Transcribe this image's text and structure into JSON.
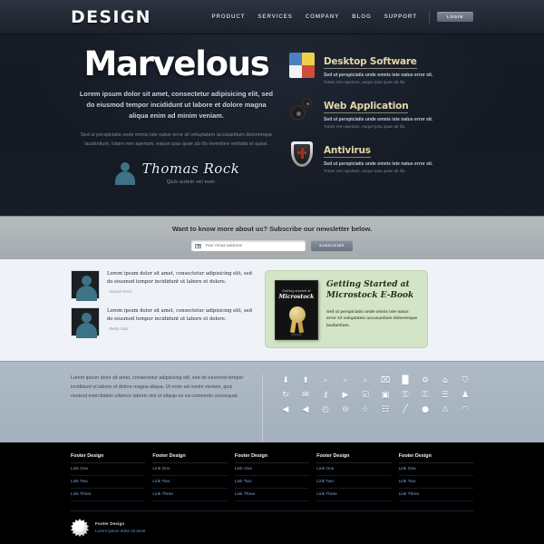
{
  "header": {
    "logo": "DESIGN",
    "nav": [
      {
        "label": "PRODUCT"
      },
      {
        "label": "SERVICES"
      },
      {
        "label": "COMPANY"
      },
      {
        "label": "BLOG"
      },
      {
        "label": "SUPPORT"
      }
    ],
    "login_label": "LOGIN"
  },
  "hero": {
    "title": "Marvelous",
    "subtitle": "Lorem ipsum dolor sit amet, consectetur adipisicing elit, sed do eiusmod tempor incididunt ut labore et dolore magna aliqua  enim ad minim veniam.",
    "body": "Sed ut perspiciatis unde omnis iste natus error sit voluptatem accusantium doloremque laudantium, totam rem aperiam, eaque ipsa quae ab illo inventore veritatis et quasi.",
    "signature_name": "Thomas Rock",
    "signature_role": "Quis autem vel eum",
    "features": [
      {
        "icon": "puzzle-icon",
        "title": "Desktop Software",
        "line1": "Sed ut perspiciatis unde omnis iste natus error sit.",
        "line2": "Totam rem aperiam, eaque ipsa quae ab illo."
      },
      {
        "icon": "gears-icon",
        "title": "Web Application",
        "line1": "Sed ut perspiciatis unde omnis iste natus error sit.",
        "line2": "Totam rem aperiam, eaque ipsa quae ab illo."
      },
      {
        "icon": "shield-icon",
        "title": "Antivirus",
        "line1": "Sed ut perspiciatis unde omnis iste natus error sit.",
        "line2": "Totam rem aperiam, eaque ipsa quae ab illo."
      }
    ]
  },
  "newsletter": {
    "title": "Want to know more about us? Subscribe our newsletter below.",
    "input_placeholder": "Your email address",
    "input_value": "",
    "button_label": "SUBSCRIBE"
  },
  "testimonials": [
    {
      "text": "Lorem ipsum dolor sit amet, consectetur adipisicing elit, sed do eiusmod tempor incididunt ut labore et dolore.",
      "author": "- Daniel Ross"
    },
    {
      "text": "Lorem ipsum dolor sit amet, consectetur adipisicing elit, sed do eiusmod tempor incididunt ut labore et dolore.",
      "author": "- Betty Diaz"
    }
  ],
  "ebook": {
    "cover_top": "Getting started at",
    "cover_title": "Microstock",
    "cover_footer": "Promo.kit",
    "title": "Getting Started at Microstock E-Book",
    "body": "Sed ut perspiciatis unde omnis iste natus error sit voluptatem accusantium doloremque laudantium."
  },
  "icons_section": {
    "paragraph": "Lorem ipsum dolor sit amet, consectetur adipisicing elit, sed do eiusmod tempor incididunt ut labore et dolore magna aliqua. Ut enim ad minim veniam, quis nostrud exercitation ullamco laboris nisi ut aliquip ex ea commodo consequat.",
    "icons": [
      {
        "name": "arrow-down-icon",
        "glyph": "⬇"
      },
      {
        "name": "arrow-up-icon",
        "glyph": "⬆"
      },
      {
        "name": "zoom-in-icon",
        "glyph": "⌕"
      },
      {
        "name": "zoom-out-icon",
        "glyph": "⌕"
      },
      {
        "name": "search-icon",
        "glyph": "⌕"
      },
      {
        "name": "trash-icon",
        "glyph": "⌧"
      },
      {
        "name": "bar-chart-icon",
        "glyph": "█"
      },
      {
        "name": "gear-icon",
        "glyph": "⚙"
      },
      {
        "name": "home-icon",
        "glyph": "⌂"
      },
      {
        "name": "cart-icon",
        "glyph": "⛉"
      },
      {
        "name": "refresh-icon",
        "glyph": "↻"
      },
      {
        "name": "mail-icon",
        "glyph": "✉"
      },
      {
        "name": "key-icon",
        "glyph": "⚷"
      },
      {
        "name": "play-icon",
        "glyph": "▶"
      },
      {
        "name": "checkbox-icon",
        "glyph": "☑"
      },
      {
        "name": "box-up-icon",
        "glyph": "▣"
      },
      {
        "name": "lock-icon",
        "glyph": "⚿"
      },
      {
        "name": "unlock-icon",
        "glyph": "⚿"
      },
      {
        "name": "document-icon",
        "glyph": "☰"
      },
      {
        "name": "user-icon",
        "glyph": "♟"
      },
      {
        "name": "volume-on-icon",
        "glyph": "◀"
      },
      {
        "name": "volume-off-icon",
        "glyph": "◀"
      },
      {
        "name": "clock-icon",
        "glyph": "◴"
      },
      {
        "name": "minus-circle-icon",
        "glyph": "⊖"
      },
      {
        "name": "star-icon",
        "glyph": "☆"
      },
      {
        "name": "calendar-icon",
        "glyph": "☷"
      },
      {
        "name": "pencil-icon",
        "glyph": "╱"
      },
      {
        "name": "chat-icon",
        "glyph": "●"
      },
      {
        "name": "warning-icon",
        "glyph": "⚠"
      },
      {
        "name": "rss-icon",
        "glyph": "◠"
      }
    ]
  },
  "footer": {
    "columns": [
      {
        "title": "Footer Design",
        "links": [
          "Link One",
          "Link Two",
          "Link Three"
        ]
      },
      {
        "title": "Footer Design",
        "links": [
          "Link One",
          "Link Two",
          "Link Three"
        ]
      },
      {
        "title": "Footer Design",
        "links": [
          "Link One",
          "Link Two",
          "Link Three"
        ]
      },
      {
        "title": "Footer Design",
        "links": [
          "Link One",
          "Link Two",
          "Link Three"
        ]
      },
      {
        "title": "Footer Design",
        "links": [
          "Link One",
          "Link Two",
          "Link Three"
        ]
      }
    ],
    "brand_title": "Footer Design",
    "brand_sub": "Lorem ipsum dolor sit amet"
  },
  "colors": {
    "header_dark": "#232935",
    "hero_dark": "#151a24",
    "newsletter_gray": "#aeb3b6",
    "testimonials_bg": "#eff3f8",
    "icons_bg": "#a8b6c2",
    "footer_black": "#000000",
    "feature_title": "#e2d7a8",
    "link_blue": "#7fa8d4",
    "ebook_green": "#d3e5c6",
    "avatar_teal": "#3d7385"
  }
}
